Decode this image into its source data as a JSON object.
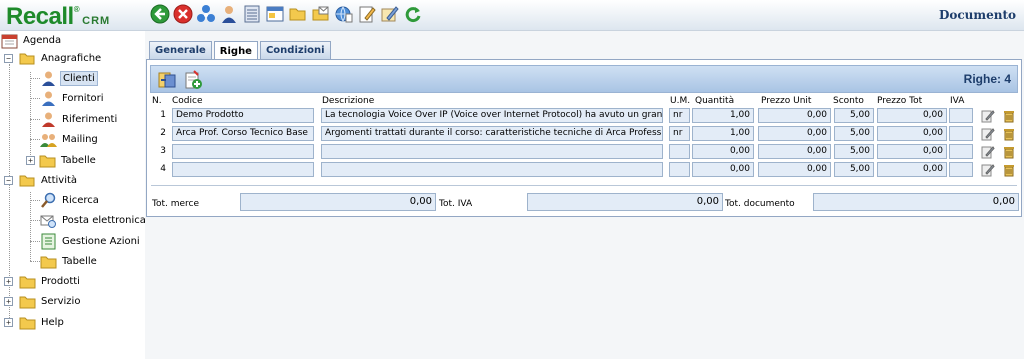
{
  "app": {
    "logo": "Recall",
    "logo_reg": "®",
    "logo_suffix": "CRM",
    "page_title": "Documento"
  },
  "toolbar": [
    {
      "icon": "back-arrow-icon"
    },
    {
      "icon": "close-x-icon"
    },
    {
      "icon": "network-globe-icon"
    },
    {
      "icon": "user-icon"
    },
    {
      "icon": "list-document-icon"
    },
    {
      "icon": "window-icon"
    },
    {
      "icon": "open-folder-icon"
    },
    {
      "icon": "mail-folder-icon"
    },
    {
      "icon": "globe-doc-icon"
    },
    {
      "icon": "edit-note-icon"
    },
    {
      "icon": "edit-pencil-icon"
    },
    {
      "icon": "refresh-icon"
    }
  ],
  "sidebar": {
    "agenda": "Agenda",
    "anagrafiche": "Anagrafiche",
    "clienti": "Clienti",
    "fornitori": "Fornitori",
    "riferimenti": "Riferimenti",
    "mailing": "Mailing",
    "tabelle1": "Tabelle",
    "attivita": "Attività",
    "ricerca": "Ricerca",
    "posta": "Posta elettronica",
    "gestione": "Gestione Azioni",
    "tabelle2": "Tabelle",
    "prodotti": "Prodotti",
    "servizio": "Servizio",
    "help": "Help"
  },
  "tabs": [
    "Generale",
    "Righe",
    "Condizioni"
  ],
  "panel": {
    "righe_label": "Righe: 4"
  },
  "columns": {
    "n": "N.",
    "codice": "Codice",
    "descrizione": "Descrizione",
    "um": "U.M.",
    "quantita": "Quantità",
    "prezzo_unit": "Prezzo Unit",
    "sconto": "Sconto",
    "prezzo_tot": "Prezzo Tot",
    "iva": "IVA"
  },
  "rows": [
    {
      "n": "1",
      "codice": "Demo Prodotto",
      "descrizione": "La tecnologia Voice Over IP (Voice over Internet Protocol) ha avuto un grande :",
      "um": "nr",
      "quantita": "1,00",
      "prezzo_unit": "0,00",
      "sconto": "5,00",
      "prezzo_tot": "0,00",
      "iva": ""
    },
    {
      "n": "2",
      "codice": "Arca Prof.  Corso Tecnico Base",
      "descrizione": "Argomenti trattati durante il corso: caratteristiche tecniche di Arca Professiona",
      "um": "nr",
      "quantita": "1,00",
      "prezzo_unit": "0,00",
      "sconto": "5,00",
      "prezzo_tot": "0,00",
      "iva": ""
    },
    {
      "n": "3",
      "codice": "",
      "descrizione": "",
      "um": "",
      "quantita": "0,00",
      "prezzo_unit": "0,00",
      "sconto": "5,00",
      "prezzo_tot": "0,00",
      "iva": ""
    },
    {
      "n": "4",
      "codice": "",
      "descrizione": "",
      "um": "",
      "quantita": "0,00",
      "prezzo_unit": "0,00",
      "sconto": "5,00",
      "prezzo_tot": "0,00",
      "iva": ""
    }
  ],
  "totals": {
    "merce_label": "Tot. merce",
    "merce": "0,00",
    "iva_label": "Tot. IVA",
    "iva": "0,00",
    "documento_label": "Tot. documento",
    "documento": "0,00"
  }
}
